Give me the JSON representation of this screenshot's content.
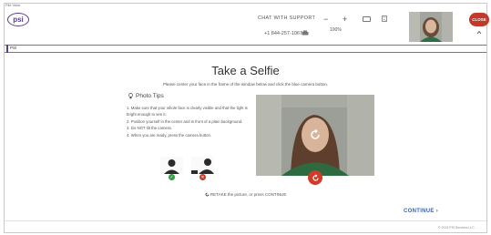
{
  "window": {
    "corner_text": "File  View"
  },
  "header": {
    "logo_text": "psi",
    "support_label": "CHAT WITH SUPPORT",
    "phone": "+1 844-257-1067",
    "zoom_minus": "−",
    "zoom_plus": "+",
    "zoom_value": "100%",
    "close_label": "CLOSE",
    "collapse_icon": "chevron-up-icon"
  },
  "tab": {
    "label": "PSI"
  },
  "main": {
    "title": "Take a Selfie",
    "subtitle": "Please center your face in the frame of the window below and click the blue camera button.",
    "tips_heading": "Photo Tips",
    "tips": [
      "1. Make sure that your whole face is clearly visible and that the light is bright enough to see it.",
      "2. Position yourself in the center and in front of a plain background.",
      "3. Do NOT tilt the camera.",
      "4. When you are ready, press the camera button."
    ],
    "retake_text": "RETAKE the picture, or press CONTINUE",
    "continue_label": "CONTINUE ›"
  },
  "footer": {
    "copyright": "© 2023 PSI Services LLC"
  },
  "colors": {
    "brand": "#5a3d8c",
    "close": "#c0392b",
    "shutter": "#d23a2a",
    "link": "#3a64b5",
    "good": "#2e9e46",
    "bad": "#c0392b"
  }
}
